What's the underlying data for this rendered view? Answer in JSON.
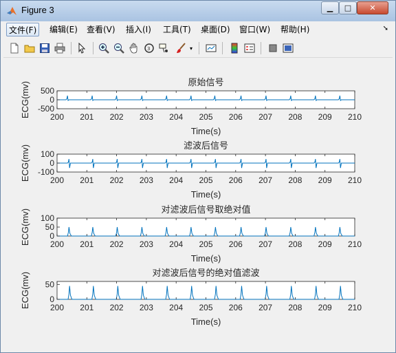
{
  "window": {
    "title": "Figure 3",
    "buttons": [
      "minimize",
      "maximize",
      "close"
    ]
  },
  "menubar": {
    "items": [
      "文件(F)",
      "编辑(E)",
      "查看(V)",
      "插入(I)",
      "工具(T)",
      "桌面(D)",
      "窗口(W)",
      "帮助(H)"
    ],
    "active_index": 0
  },
  "toolbar": {
    "icons": [
      "new-figure-icon",
      "open-file-icon",
      "save-icon",
      "print-icon",
      "pointer-icon",
      "zoom-in-icon",
      "zoom-out-icon",
      "pan-icon",
      "rotate-3d-icon",
      "data-cursor-icon",
      "brush-icon",
      "link-plot-icon",
      "colorbar-icon",
      "legend-icon",
      "hide-plot-tools-icon",
      "show-plot-tools-icon"
    ]
  },
  "colors": {
    "line": "#0072bd",
    "axes": "#262626"
  },
  "chart_data": [
    {
      "type": "line",
      "title": "原始信号",
      "xlabel": "Time(s)",
      "ylabel": "ECG(mv)",
      "xlim": [
        200,
        210
      ],
      "ylim": [
        -500,
        500
      ],
      "xticks": [
        "200",
        "201",
        "202",
        "203",
        "204",
        "205",
        "206",
        "207",
        "208",
        "209",
        "210"
      ],
      "yticks": [
        "500",
        "0",
        "-500"
      ],
      "ytick_values": [
        500,
        0,
        -500
      ],
      "series": [
        {
          "peaks": [
            200.35,
            201.18,
            202.0,
            202.85,
            203.68,
            204.5,
            205.3,
            206.18,
            207.02,
            207.85,
            208.68,
            209.5
          ],
          "peak_value": 230,
          "trough_value": -40
        }
      ]
    },
    {
      "type": "line",
      "title": "滤波后信号",
      "xlabel": "Time(s)",
      "ylabel": "ECG(mv)",
      "xlim": [
        200,
        210
      ],
      "ylim": [
        -100,
        100
      ],
      "xticks": [
        "200",
        "201",
        "202",
        "203",
        "204",
        "205",
        "206",
        "207",
        "208",
        "209",
        "210"
      ],
      "yticks": [
        "100",
        "0",
        "-100"
      ],
      "ytick_values": [
        100,
        0,
        -100
      ],
      "series": [
        {
          "peaks": [
            200.4,
            201.2,
            202.02,
            202.85,
            203.68,
            204.5,
            205.32,
            206.18,
            207.02,
            207.85,
            208.68,
            209.5
          ],
          "peak_value": 45,
          "trough_value": -55
        }
      ]
    },
    {
      "type": "line",
      "title": "对滤波后信号取绝对值",
      "xlabel": "Time(s)",
      "ylabel": "ECG(mv)",
      "xlim": [
        200,
        210
      ],
      "ylim": [
        0,
        100
      ],
      "xticks": [
        "200",
        "201",
        "202",
        "203",
        "204",
        "205",
        "206",
        "207",
        "208",
        "209",
        "210"
      ],
      "yticks": [
        "100",
        "50",
        "0"
      ],
      "ytick_values": [
        100,
        50,
        0
      ],
      "series": [
        {
          "peaks": [
            200.4,
            201.2,
            202.02,
            202.85,
            203.68,
            204.5,
            205.32,
            206.18,
            207.02,
            207.85,
            208.68,
            209.5
          ],
          "peak_value": 50,
          "trough_value": 0
        }
      ]
    },
    {
      "type": "line",
      "title": "对滤波后信号的绝对值滤波",
      "xlabel": "Time(s)",
      "ylabel": "ECG(mv)",
      "xlim": [
        200,
        210
      ],
      "ylim": [
        0,
        60
      ],
      "xticks": [
        "200",
        "201",
        "202",
        "203",
        "204",
        "205",
        "206",
        "207",
        "208",
        "209",
        "210"
      ],
      "yticks": [
        "50",
        "0"
      ],
      "ytick_values": [
        50,
        0
      ],
      "series": [
        {
          "peaks": [
            200.42,
            201.22,
            202.04,
            202.87,
            203.7,
            204.52,
            205.34,
            206.2,
            207.04,
            207.87,
            208.7,
            209.52
          ],
          "peak_value": 45,
          "trough_value": 0
        }
      ]
    }
  ]
}
